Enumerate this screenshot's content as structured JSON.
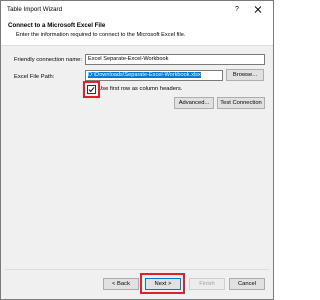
{
  "window": {
    "title": "Table Import Wizard",
    "help_glyph": "?"
  },
  "header": {
    "heading": "Connect to a Microsoft Excel File",
    "subheading": "Enter the information required to connect to the Microsoft Excel file."
  },
  "form": {
    "friendly_name_label": "Friendly connection name:",
    "friendly_name_value": "Excel Separate-Excel-Workbook",
    "file_path_label": "Excel File Path:",
    "file_path_value": "D:\\Downloads\\Separate-Excel-Workbook.xlsx",
    "browse_label": "Browse...",
    "first_row_headers_label": "Use first row as column headers.",
    "first_row_headers_checked": true,
    "advanced_label": "Advanced...",
    "test_connection_label": "Test Connection"
  },
  "footer": {
    "back_label": "< Back",
    "next_label": "Next >",
    "finish_label": "Finish",
    "cancel_label": "Cancel"
  },
  "colors": {
    "highlight": "#e0202a",
    "selection": "#0078d7"
  }
}
